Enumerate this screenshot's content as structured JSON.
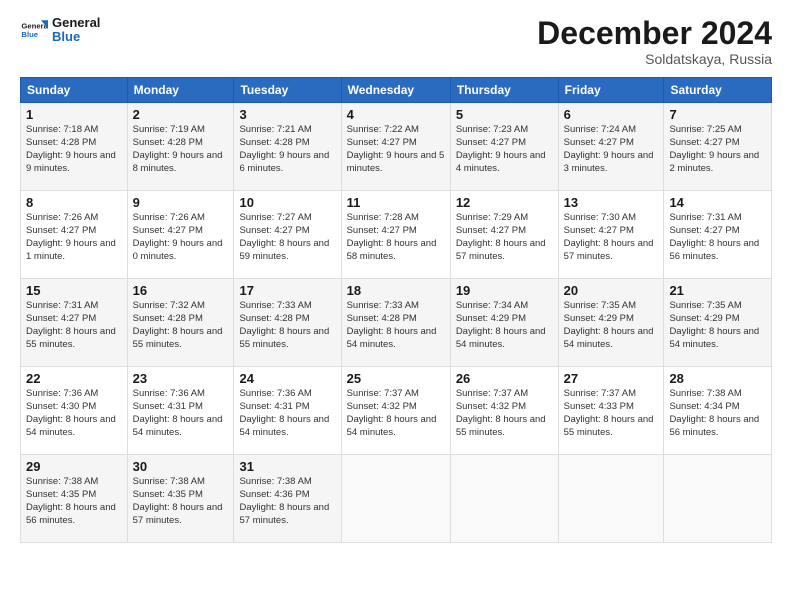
{
  "header": {
    "logo_line1": "General",
    "logo_line2": "Blue",
    "month": "December 2024",
    "location": "Soldatskaya, Russia"
  },
  "weekdays": [
    "Sunday",
    "Monday",
    "Tuesday",
    "Wednesday",
    "Thursday",
    "Friday",
    "Saturday"
  ],
  "weeks": [
    [
      {
        "day": "1",
        "sunrise": "Sunrise: 7:18 AM",
        "sunset": "Sunset: 4:28 PM",
        "daylight": "Daylight: 9 hours and 9 minutes."
      },
      {
        "day": "2",
        "sunrise": "Sunrise: 7:19 AM",
        "sunset": "Sunset: 4:28 PM",
        "daylight": "Daylight: 9 hours and 8 minutes."
      },
      {
        "day": "3",
        "sunrise": "Sunrise: 7:21 AM",
        "sunset": "Sunset: 4:28 PM",
        "daylight": "Daylight: 9 hours and 6 minutes."
      },
      {
        "day": "4",
        "sunrise": "Sunrise: 7:22 AM",
        "sunset": "Sunset: 4:27 PM",
        "daylight": "Daylight: 9 hours and 5 minutes."
      },
      {
        "day": "5",
        "sunrise": "Sunrise: 7:23 AM",
        "sunset": "Sunset: 4:27 PM",
        "daylight": "Daylight: 9 hours and 4 minutes."
      },
      {
        "day": "6",
        "sunrise": "Sunrise: 7:24 AM",
        "sunset": "Sunset: 4:27 PM",
        "daylight": "Daylight: 9 hours and 3 minutes."
      },
      {
        "day": "7",
        "sunrise": "Sunrise: 7:25 AM",
        "sunset": "Sunset: 4:27 PM",
        "daylight": "Daylight: 9 hours and 2 minutes."
      }
    ],
    [
      {
        "day": "8",
        "sunrise": "Sunrise: 7:26 AM",
        "sunset": "Sunset: 4:27 PM",
        "daylight": "Daylight: 9 hours and 1 minute."
      },
      {
        "day": "9",
        "sunrise": "Sunrise: 7:26 AM",
        "sunset": "Sunset: 4:27 PM",
        "daylight": "Daylight: 9 hours and 0 minutes."
      },
      {
        "day": "10",
        "sunrise": "Sunrise: 7:27 AM",
        "sunset": "Sunset: 4:27 PM",
        "daylight": "Daylight: 8 hours and 59 minutes."
      },
      {
        "day": "11",
        "sunrise": "Sunrise: 7:28 AM",
        "sunset": "Sunset: 4:27 PM",
        "daylight": "Daylight: 8 hours and 58 minutes."
      },
      {
        "day": "12",
        "sunrise": "Sunrise: 7:29 AM",
        "sunset": "Sunset: 4:27 PM",
        "daylight": "Daylight: 8 hours and 57 minutes."
      },
      {
        "day": "13",
        "sunrise": "Sunrise: 7:30 AM",
        "sunset": "Sunset: 4:27 PM",
        "daylight": "Daylight: 8 hours and 57 minutes."
      },
      {
        "day": "14",
        "sunrise": "Sunrise: 7:31 AM",
        "sunset": "Sunset: 4:27 PM",
        "daylight": "Daylight: 8 hours and 56 minutes."
      }
    ],
    [
      {
        "day": "15",
        "sunrise": "Sunrise: 7:31 AM",
        "sunset": "Sunset: 4:27 PM",
        "daylight": "Daylight: 8 hours and 55 minutes."
      },
      {
        "day": "16",
        "sunrise": "Sunrise: 7:32 AM",
        "sunset": "Sunset: 4:28 PM",
        "daylight": "Daylight: 8 hours and 55 minutes."
      },
      {
        "day": "17",
        "sunrise": "Sunrise: 7:33 AM",
        "sunset": "Sunset: 4:28 PM",
        "daylight": "Daylight: 8 hours and 55 minutes."
      },
      {
        "day": "18",
        "sunrise": "Sunrise: 7:33 AM",
        "sunset": "Sunset: 4:28 PM",
        "daylight": "Daylight: 8 hours and 54 minutes."
      },
      {
        "day": "19",
        "sunrise": "Sunrise: 7:34 AM",
        "sunset": "Sunset: 4:29 PM",
        "daylight": "Daylight: 8 hours and 54 minutes."
      },
      {
        "day": "20",
        "sunrise": "Sunrise: 7:35 AM",
        "sunset": "Sunset: 4:29 PM",
        "daylight": "Daylight: 8 hours and 54 minutes."
      },
      {
        "day": "21",
        "sunrise": "Sunrise: 7:35 AM",
        "sunset": "Sunset: 4:29 PM",
        "daylight": "Daylight: 8 hours and 54 minutes."
      }
    ],
    [
      {
        "day": "22",
        "sunrise": "Sunrise: 7:36 AM",
        "sunset": "Sunset: 4:30 PM",
        "daylight": "Daylight: 8 hours and 54 minutes."
      },
      {
        "day": "23",
        "sunrise": "Sunrise: 7:36 AM",
        "sunset": "Sunset: 4:31 PM",
        "daylight": "Daylight: 8 hours and 54 minutes."
      },
      {
        "day": "24",
        "sunrise": "Sunrise: 7:36 AM",
        "sunset": "Sunset: 4:31 PM",
        "daylight": "Daylight: 8 hours and 54 minutes."
      },
      {
        "day": "25",
        "sunrise": "Sunrise: 7:37 AM",
        "sunset": "Sunset: 4:32 PM",
        "daylight": "Daylight: 8 hours and 54 minutes."
      },
      {
        "day": "26",
        "sunrise": "Sunrise: 7:37 AM",
        "sunset": "Sunset: 4:32 PM",
        "daylight": "Daylight: 8 hours and 55 minutes."
      },
      {
        "day": "27",
        "sunrise": "Sunrise: 7:37 AM",
        "sunset": "Sunset: 4:33 PM",
        "daylight": "Daylight: 8 hours and 55 minutes."
      },
      {
        "day": "28",
        "sunrise": "Sunrise: 7:38 AM",
        "sunset": "Sunset: 4:34 PM",
        "daylight": "Daylight: 8 hours and 56 minutes."
      }
    ],
    [
      {
        "day": "29",
        "sunrise": "Sunrise: 7:38 AM",
        "sunset": "Sunset: 4:35 PM",
        "daylight": "Daylight: 8 hours and 56 minutes."
      },
      {
        "day": "30",
        "sunrise": "Sunrise: 7:38 AM",
        "sunset": "Sunset: 4:35 PM",
        "daylight": "Daylight: 8 hours and 57 minutes."
      },
      {
        "day": "31",
        "sunrise": "Sunrise: 7:38 AM",
        "sunset": "Sunset: 4:36 PM",
        "daylight": "Daylight: 8 hours and 57 minutes."
      },
      null,
      null,
      null,
      null
    ]
  ]
}
